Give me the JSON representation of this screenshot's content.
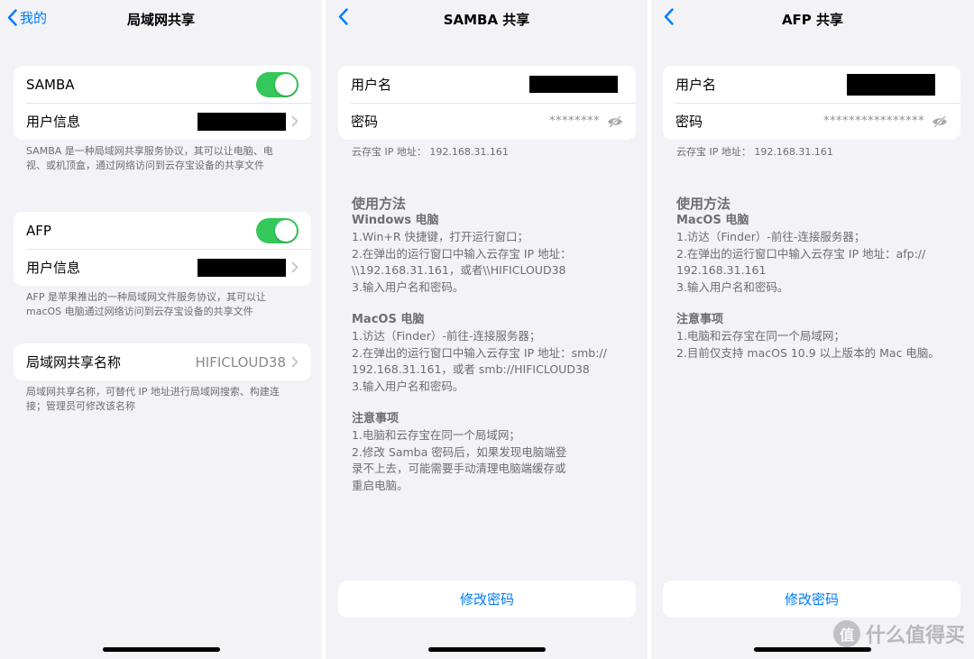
{
  "theme": {
    "accent": "#007aff",
    "toggle_on": "#34c759"
  },
  "screen1": {
    "back_label": "我的",
    "title": "局域网共享",
    "samba": {
      "label": "SAMBA",
      "enabled": true,
      "user_info_label": "用户信息"
    },
    "samba_note": "SAMBA 是一种局域网共享服务协议，其可以让电脑、电视、或机顶盒，通过网络访问到云存宝设备的共享文件",
    "afp": {
      "label": "AFP",
      "enabled": true,
      "user_info_label": "用户信息"
    },
    "afp_note": "AFP 是苹果推出的一种局域网文件服务协议，其可以让 macOS 电脑通过网络访问到云存宝设备的共享文件",
    "share_name": {
      "label": "局域网共享名称",
      "value": "HIFICLOUD38"
    },
    "share_name_note": "局域网共享名称，可替代 IP 地址进行局域网搜索、构建连接；管理员可修改该名称"
  },
  "screen2": {
    "title": "SAMBA 共享",
    "username_label": "用户名",
    "password_label": "密码",
    "password_masked": "********",
    "ip_text": "云存宝 IP 地址：  192.168.31.161",
    "usage_title": "使用方法",
    "windows_title": "Windows 电脑",
    "windows_steps": [
      "1.Win+R 快捷键，打开运行窗口；",
      "2.在弹出的运行窗口中输入云存宝 IP 地址：",
      "\\\\192.168.31.161，或者\\\\HIFICLOUD38",
      "3.输入用户名和密码。"
    ],
    "mac_title": "MacOS 电脑",
    "mac_steps": [
      "1.访达（Finder）-前往-连接服务器；",
      "2.在弹出的运行窗口中输入云存宝 IP 地址：smb://",
      "192.168.31.161，或者 smb://HIFICLOUD38",
      "3.输入用户名和密码。"
    ],
    "notes_title": "注意事项",
    "notes": [
      "1.电脑和云存宝在同一个局域网；",
      "2.修改 Samba 密码后，如果发现电脑端登",
      "录不上去，可能需要手动清理电脑端缓存或",
      "重启电脑。"
    ],
    "change_password": "修改密码"
  },
  "screen3": {
    "title": "AFP 共享",
    "username_label": "用户名",
    "password_label": "密码",
    "password_masked": "****************",
    "ip_text": "云存宝 IP 地址：  192.168.31.161",
    "usage_title": "使用方法",
    "mac_title": "MacOS 电脑",
    "mac_steps": [
      "1.访达（Finder）-前往-连接服务器；",
      "2.在弹出的运行窗口中输入云存宝 IP 地址：afp://",
      "192.168.31.161",
      "3.输入用户名和密码。"
    ],
    "notes_title": "注意事项",
    "notes": [
      "1.电脑和云存宝在同一个局域网；",
      "2.目前仅支持 macOS 10.9 以上版本的 Mac 电脑。"
    ],
    "change_password": "修改密码"
  },
  "watermark": {
    "badge": "值",
    "text": "什么值得买"
  }
}
